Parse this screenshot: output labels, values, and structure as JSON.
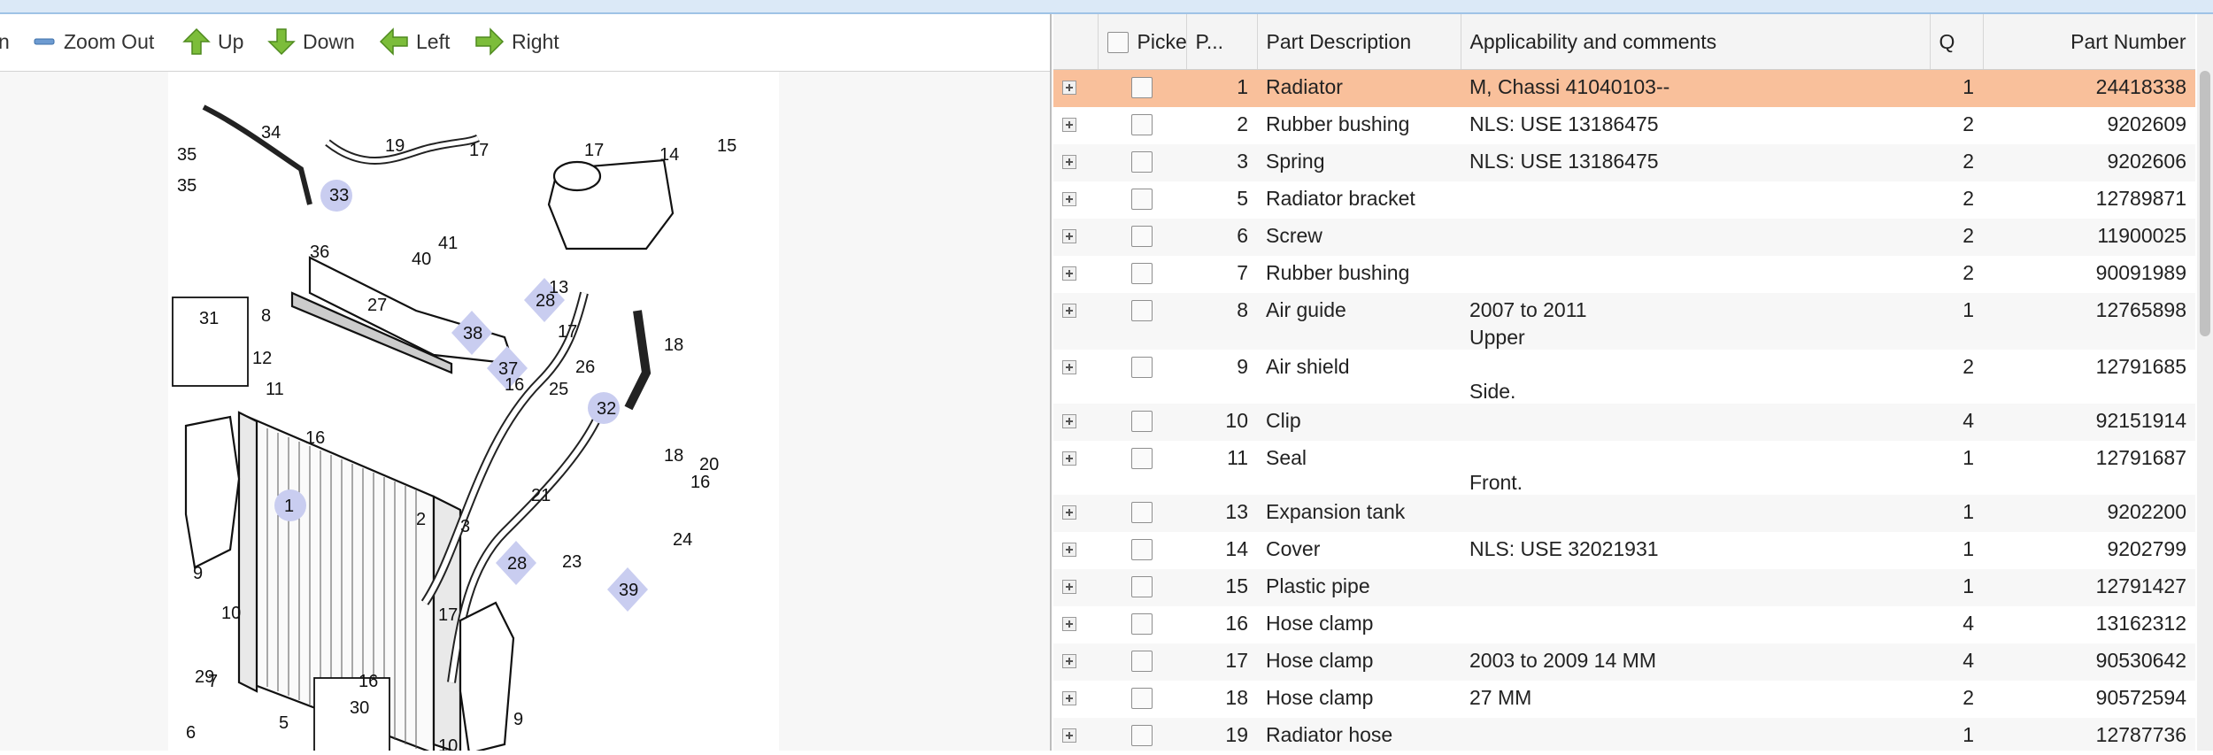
{
  "toolbar": {
    "zoom_in_fragment": "n",
    "zoom_out": "Zoom Out",
    "up": "Up",
    "down": "Down",
    "left": "Left",
    "right": "Right"
  },
  "diagram": {
    "callouts": [
      "1",
      "2",
      "3",
      "5",
      "6",
      "7",
      "7",
      "8",
      "9",
      "9",
      "10",
      "10",
      "11",
      "12",
      "13",
      "14",
      "15",
      "16",
      "16",
      "16",
      "16",
      "17",
      "17",
      "17",
      "17",
      "18",
      "18",
      "19",
      "20",
      "21",
      "23",
      "24",
      "25",
      "26",
      "27",
      "28",
      "29",
      "30",
      "31",
      "32",
      "33",
      "34",
      "35",
      "35",
      "36",
      "37",
      "38",
      "39",
      "40",
      "41"
    ]
  },
  "table": {
    "headers": {
      "picked": "Picked",
      "position": "P...",
      "description": "Part Description",
      "applicability": "Applicability and comments",
      "qty": "Q",
      "part_number": "Part Number"
    },
    "rows": [
      {
        "pos": "1",
        "desc": "Radiator",
        "app": "M, Chassi 41040103--",
        "app2": "",
        "qty": "1",
        "pn": "24418338"
      },
      {
        "pos": "2",
        "desc": "Rubber bushing",
        "app": "NLS: USE 13186475",
        "app2": "",
        "qty": "2",
        "pn": "9202609"
      },
      {
        "pos": "3",
        "desc": "Spring",
        "app": "NLS: USE 13186475",
        "app2": "",
        "qty": "2",
        "pn": "9202606"
      },
      {
        "pos": "5",
        "desc": "Radiator bracket",
        "app": "",
        "app2": "",
        "qty": "2",
        "pn": "12789871"
      },
      {
        "pos": "6",
        "desc": "Screw",
        "app": "",
        "app2": "",
        "qty": "2",
        "pn": "11900025"
      },
      {
        "pos": "7",
        "desc": "Rubber bushing",
        "app": "",
        "app2": "",
        "qty": "2",
        "pn": "90091989"
      },
      {
        "pos": "8",
        "desc": "Air guide",
        "app": "2007 to 2011",
        "app2": "Upper",
        "qty": "1",
        "pn": "12765898"
      },
      {
        "pos": "9",
        "desc": "Air shield",
        "app": "",
        "app2": "Side.",
        "qty": "2",
        "pn": "12791685"
      },
      {
        "pos": "10",
        "desc": "Clip",
        "app": "",
        "app2": "",
        "qty": "4",
        "pn": "92151914"
      },
      {
        "pos": "11",
        "desc": "Seal",
        "app": "",
        "app2": "Front.",
        "qty": "1",
        "pn": "12791687"
      },
      {
        "pos": "13",
        "desc": "Expansion tank",
        "app": "",
        "app2": "",
        "qty": "1",
        "pn": "9202200"
      },
      {
        "pos": "14",
        "desc": "Cover",
        "app": "NLS: USE 32021931",
        "app2": "",
        "qty": "1",
        "pn": "9202799"
      },
      {
        "pos": "15",
        "desc": "Plastic pipe",
        "app": "",
        "app2": "",
        "qty": "1",
        "pn": "12791427"
      },
      {
        "pos": "16",
        "desc": "Hose clamp",
        "app": "",
        "app2": "",
        "qty": "4",
        "pn": "13162312"
      },
      {
        "pos": "17",
        "desc": "Hose clamp",
        "app": "2003 to 2009 14 MM",
        "app2": "",
        "qty": "4",
        "pn": "90530642"
      },
      {
        "pos": "18",
        "desc": "Hose clamp",
        "app": "27 MM",
        "app2": "",
        "qty": "2",
        "pn": "90572594"
      },
      {
        "pos": "19",
        "desc": "Radiator hose",
        "app": "",
        "app2": "",
        "qty": "1",
        "pn": "12787736"
      }
    ]
  }
}
